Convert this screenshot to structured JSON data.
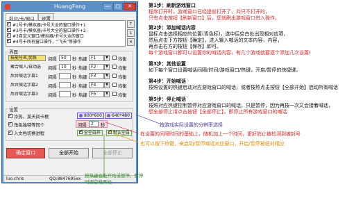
{
  "window": {
    "title": "HuangFeng",
    "buttons": [
      "—",
      "▢",
      "✕"
    ]
  },
  "tabs": [
    "前台/卡/窗口",
    "设置"
  ],
  "window_list": [
    "#1号卡/模拟器/卡号大全的窗口操作+1",
    "#2号卡/模拟器/卡号大全的窗口操作+2",
    "#3自定义窗口/模拟器/卡号大全的窗口",
    "#4号卡所有窗口操作，“飞天”等操作"
  ],
  "side_buttons": [
    "↑",
    "↓",
    "✕"
  ],
  "group_titles": [
    "界面",
    "设置"
  ],
  "rows": [
    {
      "name": "技能号名,优质",
      "label": "间隔",
      "interval": "50",
      "unit": "秒",
      "hotkey_label": "热键",
      "hotkey": "F1",
      "tail": "均衡"
    },
    {
      "name": "聚合喊人/自动选",
      "label": "间隔",
      "interval": "10",
      "unit": "秒",
      "hotkey_label": "热键",
      "hotkey": "F2",
      "tail": "均衡"
    },
    {
      "name": "后台喊话字幕1",
      "label": "间隔",
      "interval": "",
      "unit": "秒",
      "hotkey_label": "热键",
      "hotkey": "F3",
      "tail": "均衡"
    },
    {
      "name": "后台喊话字幕2",
      "label": "间隔",
      "interval": "",
      "unit": "秒",
      "hotkey_label": "热键",
      "hotkey": "F4",
      "tail": "均衡"
    },
    {
      "name": "后台喊话字幕3",
      "label": "间隔",
      "interval": "",
      "unit": "秒",
      "hotkey_label": "热键",
      "hotkey": "F5",
      "tail": "均衡"
    }
  ],
  "settings": {
    "checks": [
      {
        "label": "冷热、某天间卡框",
        "checked": true
      },
      {
        "label": "角色独特等同个",
        "checked": true
      },
      {
        "label": "入文档切换进程",
        "checked": true
      }
    ],
    "resolution_a": "800*600",
    "resolution_b": "640*480",
    "interval_label": "间隔",
    "interval_value": "2",
    "interval_unit": "秒",
    "shortcut_a": "全空白开",
    "shortcut_b": "默认空白"
  },
  "buttons": {
    "pick_window": "确定窗口",
    "start_all": "全部开始",
    "stop_all": "全部停止"
  },
  "status": {
    "author": "luo.chris",
    "qq": "QQ:8847695xx"
  },
  "annotations": {
    "steps": [
      {
        "title": "第1步：刷新游戏窗口",
        "lines": [
          "程序打开时，游戏窗口已经提前打开了，共只不打开的，",
          "只有点击按钮【刷新窗口】后，您就刷出游戏窗口进入操作。"
        ]
      },
      {
        "title": "第2步：添加喊话内容",
        "lines": [
          "鼠标点击选择相应的位置(青色标)，选中后空白处出现相对应项，",
          "然后点击下方按钮【确定】，进入输入喊话的文本内容，内容，",
          "再点击右方的按钮【保存】即可。"
        ],
        "warn": "每个游戏窗口都可以设置你的喊话内容，有几个游戏就要逐个添加几次设置!"
      },
      {
        "title": "第3步：其他设置",
        "lines": [
          "如下每个窗口设置喊话间隔/时间/游戏窗口/热键，开启/暂停的快捷键。"
        ]
      },
      {
        "title": "第4步：开始喊话",
        "lines": [
          "按照设置的热键启动对应游戏窗口的喊话，或者按热点击按钮【全部开始】启动所有喊话"
        ]
      },
      {
        "title": "第5步：停止喊话",
        "lines": [
          "按照对应热键控制暂停对应游戏窗口的喊话，只是暂停，因为再按一次又会接着喊话，",
          "想全部停止请点击按钮【全部停止】，即停止所有游戏窗口的喊话"
        ]
      }
    ],
    "callout_resolution": "按游戏实际设置的分辨率选择",
    "callout_interval": "在设置的间隔时间的基础上，随机加上一个时间，更好防止被检测到被封号",
    "callout_hotkey": "也可以按下热键，来启动/暂停喊话对应窗口，开启/暂停按钮对相应",
    "callout_bottom": "按热键也能开始或暂停，暂停时按空格开始"
  }
}
